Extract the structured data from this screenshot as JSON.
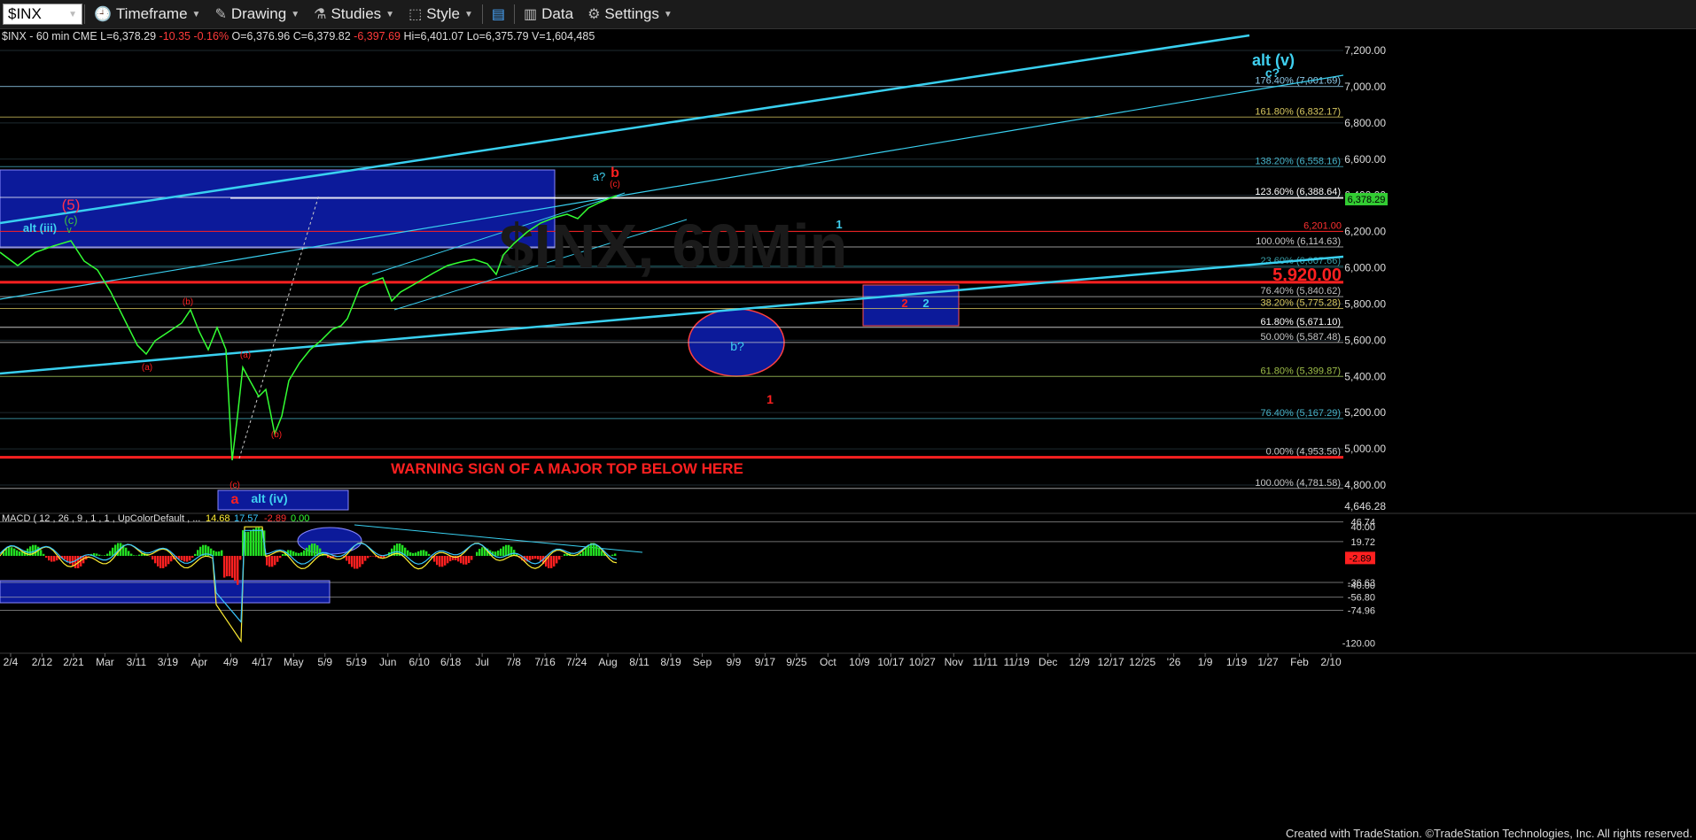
{
  "toolbar": {
    "symbol": "$INX",
    "items": [
      {
        "label": "Timeframe",
        "icon": "clock-icon"
      },
      {
        "label": "Drawing",
        "icon": "pencil-icon"
      },
      {
        "label": "Studies",
        "icon": "flask-icon"
      },
      {
        "label": "Style",
        "icon": "style-icon"
      },
      {
        "label": "",
        "icon": "layout-icon"
      },
      {
        "label": "Data",
        "icon": "bar-chart-icon"
      },
      {
        "label": "Settings",
        "icon": "gear-icon"
      }
    ]
  },
  "quote": {
    "text1": "$INX - 60 min  CME  L=6,378.29 ",
    "change": "-10.35 -0.16%",
    "text2": " O=6,376.96  C=6,379.82  ",
    "c2": "-6,397.69",
    "text3": "  Hi=6,401.07  Lo=6,375.79  V=1,604,485"
  },
  "price_axis": {
    "labels": [
      "7,200.00",
      "7,000.00",
      "6,800.00",
      "6,600.00",
      "6,400.00",
      "6,200.00",
      "6,000.00",
      "5,800.00",
      "5,600.00",
      "5,400.00",
      "5,200.00",
      "5,000.00",
      "4,800.00",
      "4,646.28"
    ],
    "last_price": "6,378.29"
  },
  "fib_levels": [
    {
      "label": "176.40% (7,001.69)",
      "price": 7001.69,
      "color": "#8ec9e8"
    },
    {
      "label": "161.80% (6,832.17)",
      "price": 6832.17,
      "color": "#d8c860"
    },
    {
      "label": "138.20% (6,558.16)",
      "price": 6558.16,
      "color": "#47b3c9"
    },
    {
      "label": "123.60% (6,388.64)",
      "price": 6388.64,
      "color": "#ffffff"
    },
    {
      "label": "100.00% (6,114.63)",
      "price": 6114.63,
      "color": "#c8c8c8"
    },
    {
      "label": "23.60% (6,007.66)",
      "price": 6007.66,
      "color": "#3a9fa8"
    },
    {
      "label": "76.40% (5,840.62)",
      "price": 5840.62,
      "color": "#bfbfbf"
    },
    {
      "label": "38.20% (5,775.28)",
      "price": 5775.28,
      "color": "#d8c860"
    },
    {
      "label": "61.80% (5,671.10)",
      "price": 5671.1,
      "color": "#ffffff"
    },
    {
      "label": "50.00% (5,587.48)",
      "price": 5587.48,
      "color": "#c8c8c8"
    },
    {
      "label": "61.80% (5,399.87)",
      "price": 5399.87,
      "color": "#9fbf4a"
    },
    {
      "label": "76.40% (5,167.29)",
      "price": 5167.29,
      "color": "#47b3c9"
    },
    {
      "label": "0.00% (4,953.56)",
      "price": 4953.56,
      "color": "#c8c8c8"
    },
    {
      "label": "100.00% (4,781.58)",
      "price": 4781.58,
      "color": "#c8c8c8"
    }
  ],
  "red_levels": {
    "label_5920": "5,920.00",
    "label_6201": "6,201.00",
    "price_5920": 5920,
    "price_6201": 6201,
    "price_4953": 4953.56
  },
  "wave_labels": [
    {
      "text": "alt (v)",
      "color": "#3fd0f0"
    },
    {
      "text": "c?",
      "color": "#3fd0f0"
    },
    {
      "text": "alt (iii)",
      "color": "#3fd0f0"
    },
    {
      "text": "(5)",
      "color": "#ff3050"
    },
    {
      "text": "(c)",
      "color": "#3fc33f"
    },
    {
      "text": "v",
      "color": "#3fc33f"
    },
    {
      "text": "a?",
      "color": "#3fd0f0"
    },
    {
      "text": "b",
      "color": "#ff2020"
    },
    {
      "text": "(c)",
      "color": "#ff2020"
    },
    {
      "text": "1",
      "color": "#3fd0f0"
    },
    {
      "text": "2",
      "color": "#ff2020"
    },
    {
      "text": "2",
      "color": "#3fd0f0"
    },
    {
      "text": "b?",
      "color": "#3fd0f0"
    },
    {
      "text": "1",
      "color": "#ff2020"
    },
    {
      "text": "(b)",
      "color": "#ff2020"
    },
    {
      "text": "(a)",
      "color": "#ff2020"
    },
    {
      "text": "(a)",
      "color": "#ff2020"
    },
    {
      "text": "(b)",
      "color": "#ff2020"
    },
    {
      "text": "(c)",
      "color": "#ff2020"
    },
    {
      "text": "a",
      "color": "#ff2020"
    },
    {
      "text": "alt (iv)",
      "color": "#3fd0f0"
    }
  ],
  "warning_text": "WARNING SIGN OF A MAJOR TOP BELOW HERE",
  "watermark": "$INX, 60Min",
  "macd": {
    "title": "MACD ( 12 , 26 , 9 , 1 , 1 , UpColorDefault , ...",
    "v1": "14.68",
    "v2": "17.57",
    "v3": "-2.89",
    "v4": "0.00",
    "axis_labels": [
      "46.74",
      "40.00",
      "19.72",
      "-2.89",
      "-36.63",
      "-40.00",
      "-56.80",
      "-74.96",
      "-120.00"
    ]
  },
  "time_axis": [
    "2/4",
    "2/12",
    "2/21",
    "Mar",
    "3/11",
    "3/19",
    "Apr",
    "4/9",
    "4/17",
    "May",
    "5/9",
    "5/19",
    "Jun",
    "6/10",
    "6/18",
    "Jul",
    "7/8",
    "7/16",
    "7/24",
    "Aug",
    "8/11",
    "8/19",
    "Sep",
    "9/9",
    "9/17",
    "9/25",
    "Oct",
    "10/9",
    "10/17",
    "10/27",
    "Nov",
    "11/11",
    "11/19",
    "Dec",
    "12/9",
    "12/17",
    "12/25",
    "'26",
    "1/9",
    "1/19",
    "1/27",
    "Feb",
    "2/10"
  ],
  "credit": "Created with TradeStation. ©TradeStation Technologies, Inc. All rights reserved.",
  "colors": {
    "background": "#000000",
    "cyan_trend": "#39d0f0",
    "blue_box": "#0c1a9a",
    "red_line": "#ff2020",
    "price_green": "#33ff33",
    "macd_pos": "#22dd22",
    "macd_neg": "#ff2020"
  }
}
